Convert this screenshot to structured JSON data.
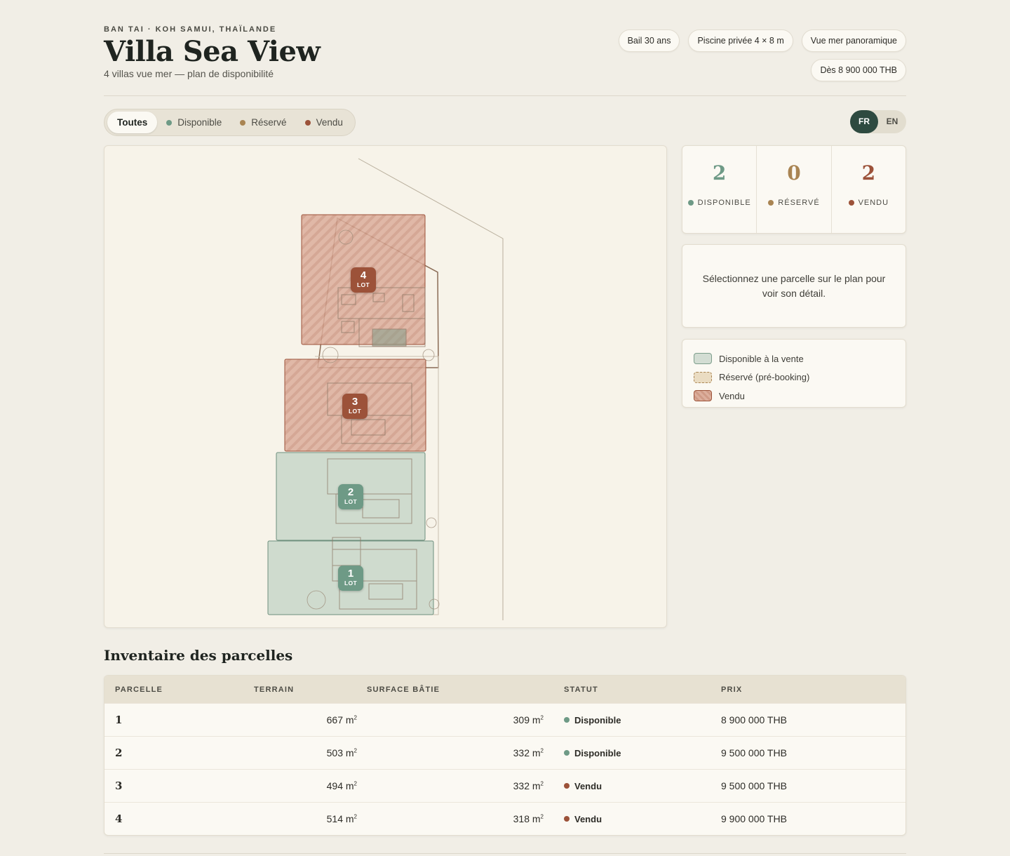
{
  "header": {
    "eyebrow": "BAN TAI · KOH SAMUI, THAÏLANDE",
    "title": "Villa Sea View",
    "subtitle": "4 villas vue mer — plan de disponibilité",
    "chips": [
      "Bail 30 ans",
      "Piscine privée 4 × 8 m",
      "Vue mer panoramique",
      "Dès 8 900 000 THB"
    ]
  },
  "colors": {
    "available": "#6e9a86",
    "reserved": "#a98452",
    "sold": "#9c5239",
    "accent": "#2e4a40"
  },
  "filters": [
    {
      "label": "Toutes",
      "active": true
    },
    {
      "label": "Disponible",
      "dot": "#6e9a86"
    },
    {
      "label": "Réservé",
      "dot": "#a98452"
    },
    {
      "label": "Vendu",
      "dot": "#9c5239"
    }
  ],
  "lang": {
    "fr": "FR",
    "en": "EN",
    "active": "FR"
  },
  "map": {
    "lots": [
      {
        "number": "4",
        "label": "LOT",
        "status": "sold"
      },
      {
        "number": "3",
        "label": "LOT",
        "status": "sold"
      },
      {
        "number": "2",
        "label": "LOT",
        "status": "available"
      },
      {
        "number": "1",
        "label": "LOT",
        "status": "available"
      }
    ]
  },
  "stats": [
    {
      "value": "2",
      "label": "DISPONIBLE",
      "color": "#6e9a86"
    },
    {
      "value": "0",
      "label": "RÉSERVÉ",
      "color": "#a98452"
    },
    {
      "value": "2",
      "label": "VENDU",
      "color": "#9c5239"
    }
  ],
  "detail": {
    "placeholder": "Sélectionnez une parcelle sur le plan pour voir son détail."
  },
  "legend": [
    {
      "label": "Disponible à la vente",
      "status": "available"
    },
    {
      "label": "Réservé (pré-booking)",
      "status": "reserved"
    },
    {
      "label": "Vendu",
      "status": "sold"
    }
  ],
  "inventory": {
    "title": "Inventaire des parcelles",
    "headers": [
      "PARCELLE",
      "TERRAIN",
      "SURFACE BÂTIE",
      "STATUT",
      "PRIX"
    ],
    "unit": "m²",
    "rows": [
      {
        "parcel": "1",
        "land": "667 m",
        "built": "309 m",
        "status": "Disponible",
        "status_color": "#6e9a86",
        "price": "8 900 000 THB"
      },
      {
        "parcel": "2",
        "land": "503 m",
        "built": "332 m",
        "status": "Disponible",
        "status_color": "#6e9a86",
        "price": "9 500 000 THB"
      },
      {
        "parcel": "3",
        "land": "494 m",
        "built": "332 m",
        "status": "Vendu",
        "status_color": "#9c5239",
        "price": "9 500 000 THB"
      },
      {
        "parcel": "4",
        "land": "514 m",
        "built": "318 m",
        "status": "Vendu",
        "status_color": "#9c5239",
        "price": "9 900 000 THB"
      }
    ]
  }
}
